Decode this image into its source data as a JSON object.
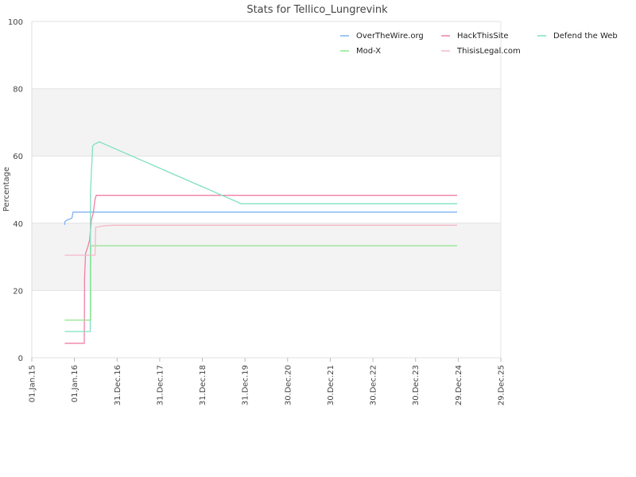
{
  "chart_data": {
    "type": "line",
    "title": "Stats for Tellico_Lungrevink",
    "ylabel": "Percentage",
    "xlabel": "",
    "ylim": [
      0,
      100
    ],
    "y_ticks": [
      0,
      20,
      40,
      60,
      80,
      100
    ],
    "x_ticks": [
      "01.Jan.15",
      "01.Jan.16",
      "31.Dec.16",
      "31.Dec.17",
      "31.Dec.18",
      "31.Dec.19",
      "30.Dec.20",
      "30.Dec.21",
      "30.Dec.22",
      "30.Dec.23",
      "29.Dec.24",
      "29.Dec.25"
    ],
    "grid": "horizontal bands",
    "legend_position": "top-right",
    "series": [
      {
        "name": "OverTheWire.org",
        "color": "#7fb2f0",
        "points": [
          [
            "2015-10-10",
            39.5
          ],
          [
            "2015-10-11",
            40.5
          ],
          [
            "2015-11-01",
            41.0
          ],
          [
            "2015-12-10",
            41.5
          ],
          [
            "2015-12-20",
            43.3
          ],
          [
            "2024-12-20",
            43.3
          ]
        ]
      },
      {
        "name": "HackThisSite",
        "color": "#f07fa6",
        "points": [
          [
            "2015-10-10",
            4.3
          ],
          [
            "2016-03-25",
            4.3
          ],
          [
            "2016-03-28",
            24.0
          ],
          [
            "2016-04-05",
            31.0
          ],
          [
            "2016-04-25",
            33.0
          ],
          [
            "2016-05-10",
            35.0
          ],
          [
            "2016-05-25",
            41.0
          ],
          [
            "2016-06-10",
            43.0
          ],
          [
            "2016-06-25",
            47.0
          ],
          [
            "2016-07-05",
            48.3
          ],
          [
            "2024-12-20",
            48.3
          ]
        ]
      },
      {
        "name": "Defend the Web",
        "color": "#7fe0c2",
        "points": [
          [
            "2015-10-10",
            7.8
          ],
          [
            "2016-05-15",
            7.8
          ],
          [
            "2016-05-17",
            49.0
          ],
          [
            "2016-05-25",
            55.0
          ],
          [
            "2016-06-05",
            63.0
          ],
          [
            "2016-06-20",
            63.5
          ],
          [
            "2016-08-01",
            64.2
          ],
          [
            "2019-11-30",
            45.8
          ],
          [
            "2024-12-20",
            45.8
          ]
        ]
      },
      {
        "name": "Mod-X",
        "color": "#8ee68e",
        "points": [
          [
            "2015-10-10",
            11.2
          ],
          [
            "2016-05-18",
            11.2
          ],
          [
            "2016-05-20",
            33.3
          ],
          [
            "2024-12-20",
            33.3
          ]
        ]
      },
      {
        "name": "ThisisLegal.com",
        "color": "#f5b8c8",
        "points": [
          [
            "2015-10-10",
            30.5
          ],
          [
            "2016-06-25",
            30.5
          ],
          [
            "2016-07-01",
            38.8
          ],
          [
            "2016-09-01",
            39.2
          ],
          [
            "2016-12-01",
            39.4
          ],
          [
            "2024-12-20",
            39.4
          ]
        ]
      }
    ]
  }
}
